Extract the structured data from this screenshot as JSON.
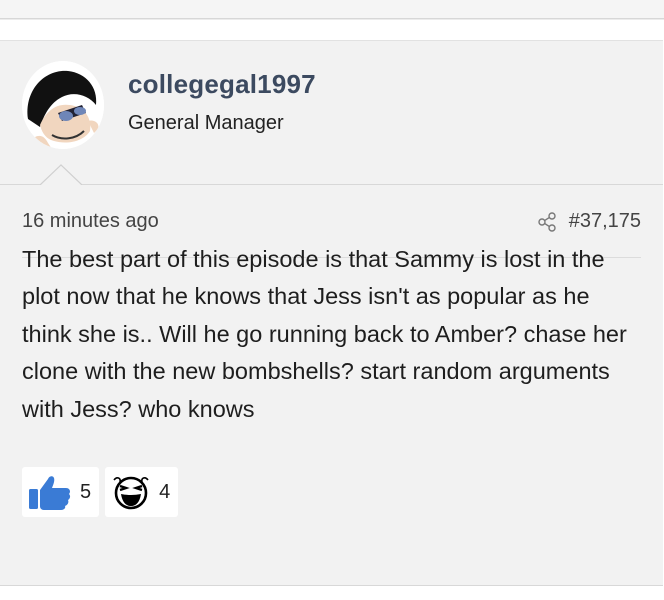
{
  "author": {
    "username": "collegegal1997",
    "role": "General Manager"
  },
  "meta": {
    "time": "16 minutes ago",
    "post_number": "#37,175"
  },
  "post": {
    "text": "The best part of this episode is that Sammy is lost in the plot now that he knows that Jess isn't as popular as he think she is.. Will he go running back to Amber? chase her clone with the new bombshells? start random arguments with Jess? who knows"
  },
  "reactions": [
    {
      "icon": "thumbs-up-icon",
      "count": "5",
      "color": "#3a7bd5"
    },
    {
      "icon": "laughing-face-icon",
      "count": "4",
      "color": "#000000"
    }
  ]
}
